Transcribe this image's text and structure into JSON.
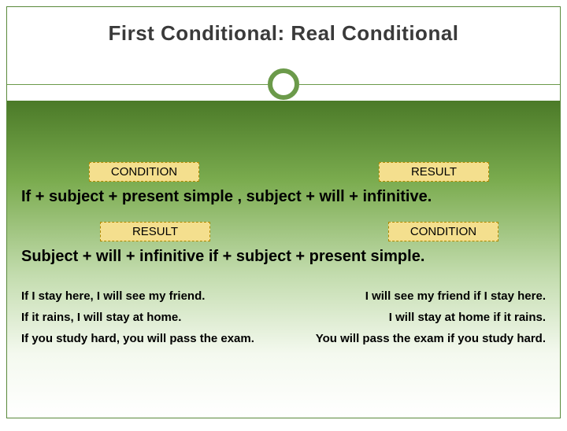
{
  "title": "First Conditional: Real Conditional",
  "section1": {
    "label_left": "CONDITION",
    "label_right": "RESULT",
    "formula": "If + subject + present simple , subject  +  will + infinitive."
  },
  "section2": {
    "label_left": "RESULT",
    "label_right": "CONDITION",
    "formula": "Subject  +  will + infinitive if  + subject + present simple."
  },
  "examples": [
    {
      "left": "If I stay here, I will see my friend.",
      "right": "I will see my friend if I stay here."
    },
    {
      "left": "If it rains, I will stay at home.",
      "right": "I will stay at home if it rains."
    },
    {
      "left": "If you study hard, you will pass the exam.",
      "right": "You will pass the exam if you study hard."
    }
  ]
}
